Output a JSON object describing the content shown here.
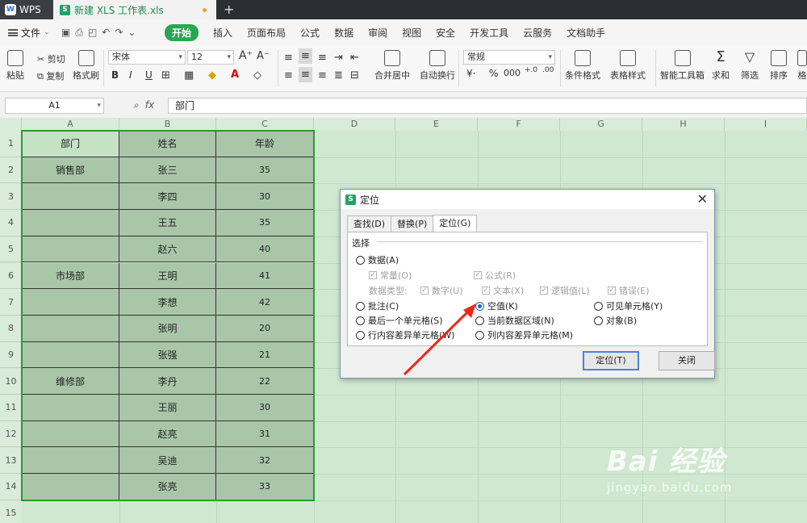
{
  "titlebar": {
    "app_tab": "WPS",
    "doc_tab": "新建 XLS 工作表.xls",
    "new_tab": "+"
  },
  "menubar": {
    "file": "文件",
    "start": "开始",
    "items": [
      "插入",
      "页面布局",
      "公式",
      "数据",
      "审阅",
      "视图",
      "安全",
      "开发工具",
      "云服务",
      "文档助手"
    ]
  },
  "ribbon": {
    "paste": "粘贴",
    "cut": "剪切",
    "copy": "复制",
    "format_painter": "格式刷",
    "font_name": "宋体",
    "font_size": "12",
    "merge_center": "合并居中",
    "wrap_text": "自动换行",
    "number_format": "常规",
    "cond_format": "条件格式",
    "table_style": "表格样式",
    "smart_toolbox": "智能工具箱",
    "sum": "求和",
    "filter": "筛选",
    "sort": "排序",
    "format_cut": "格"
  },
  "formula_bar": {
    "cell_ref": "A1",
    "fx": "fx",
    "content": "部门"
  },
  "columns": [
    "A",
    "B",
    "C",
    "D",
    "E",
    "F",
    "G",
    "H",
    "I"
  ],
  "rows": [
    "1",
    "2",
    "3",
    "4",
    "5",
    "6",
    "7",
    "8",
    "9",
    "10",
    "11",
    "12",
    "13",
    "14",
    "15"
  ],
  "table": {
    "headers": [
      "部门",
      "姓名",
      "年龄"
    ],
    "data": [
      [
        "销售部",
        "张三",
        "35"
      ],
      [
        "",
        "李四",
        "30"
      ],
      [
        "",
        "王五",
        "35"
      ],
      [
        "",
        "赵六",
        "40"
      ],
      [
        "市场部",
        "王明",
        "41"
      ],
      [
        "",
        "李想",
        "42"
      ],
      [
        "",
        "张明",
        "20"
      ],
      [
        "",
        "张强",
        "21"
      ],
      [
        "维修部",
        "李丹",
        "22"
      ],
      [
        "",
        "王丽",
        "30"
      ],
      [
        "",
        "赵亮",
        "31"
      ],
      [
        "",
        "吴迪",
        "32"
      ],
      [
        "",
        "张亮",
        "33"
      ]
    ]
  },
  "dialog": {
    "title": "定位",
    "tabs": [
      "查找(D)",
      "替换(P)",
      "定位(G)"
    ],
    "group_label": "选择",
    "opt_data": "数据(A)",
    "sub_constant": "常量(O)",
    "sub_formula": "公式(R)",
    "data_type_label": "数据类型:",
    "sub_number": "数字(U)",
    "sub_text": "文本(X)",
    "sub_logic": "逻辑值(L)",
    "sub_error": "错误(E)",
    "opt_comment": "批注(C)",
    "opt_blank": "空值(K)",
    "opt_visible": "可见单元格(Y)",
    "opt_last": "最后一个单元格(S)",
    "opt_region": "当前数据区域(N)",
    "opt_object": "对象(B)",
    "opt_row_diff": "行内容差异单元格(W)",
    "opt_col_diff": "列内容差异单元格(M)",
    "btn_locate": "定位(T)",
    "btn_close": "关闭"
  },
  "watermark": {
    "brand": "Bai 经验",
    "url": "jingyan.baidu.com"
  }
}
